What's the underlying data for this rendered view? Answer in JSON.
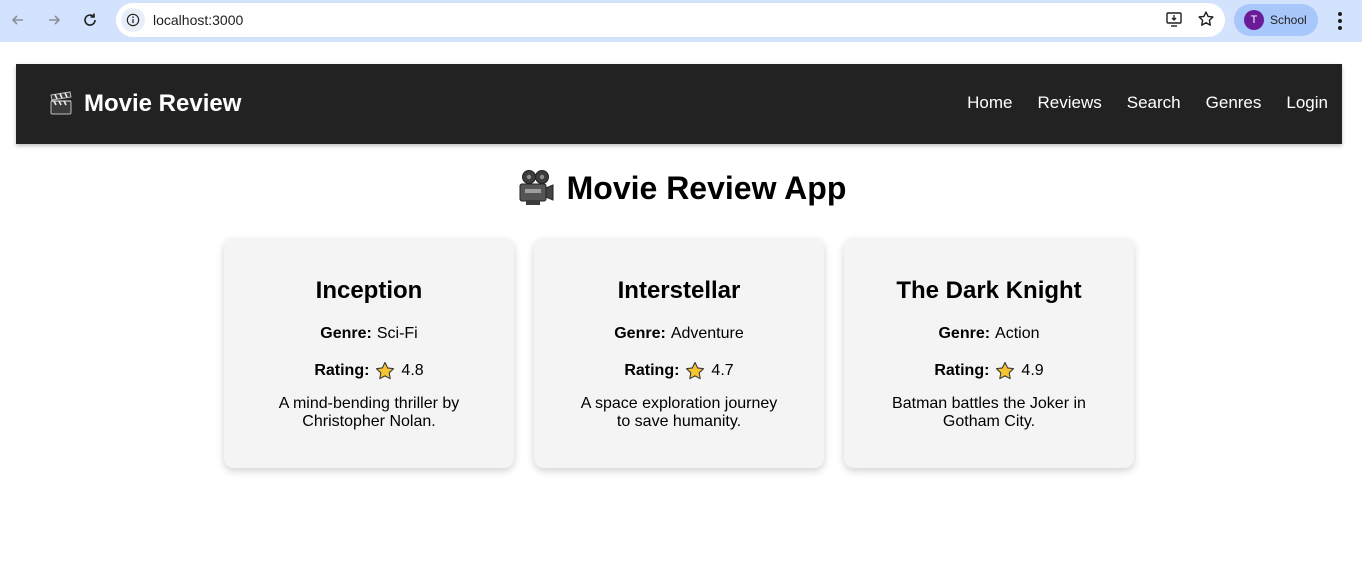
{
  "browser": {
    "url": "localhost:3000",
    "profile_initial": "T",
    "profile_name": "School"
  },
  "navbar": {
    "brand": "Movie Review",
    "brand_icon": "clapperboard-icon",
    "links": [
      "Home",
      "Reviews",
      "Search",
      "Genres",
      "Login"
    ]
  },
  "main": {
    "title": "Movie Review App",
    "title_icon": "movie-camera-icon",
    "genre_label": "Genre:",
    "rating_label": "Rating:",
    "movies": [
      {
        "title": "Inception",
        "genre": "Sci-Fi",
        "rating": "4.8",
        "description": "A mind-bending thriller by Christopher Nolan."
      },
      {
        "title": "Interstellar",
        "genre": "Adventure",
        "rating": "4.7",
        "description": "A space exploration journey to save humanity."
      },
      {
        "title": "The Dark Knight",
        "genre": "Action",
        "rating": "4.9",
        "description": "Batman battles the Joker in Gotham City."
      }
    ]
  },
  "colors": {
    "chrome_bg": "#d3e3fd",
    "navbar_bg": "#222222",
    "card_bg": "#f4f4f4",
    "star": "#f6c431"
  }
}
